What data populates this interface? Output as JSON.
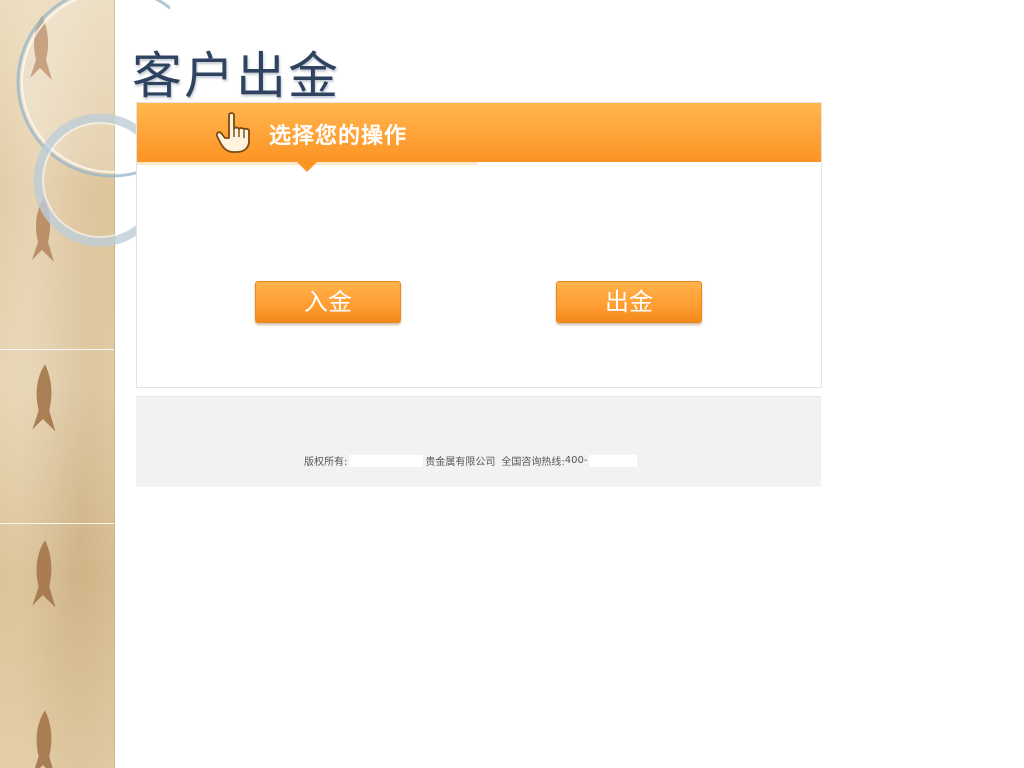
{
  "page": {
    "title": "客户出金"
  },
  "panel": {
    "header_title": "选择您的操作",
    "icon": "pointing-hand-icon"
  },
  "buttons": {
    "deposit_label": "入金",
    "withdraw_label": "出金"
  },
  "footer": {
    "copyright_prefix": "版权所有:",
    "company_suffix": "贵金属有限公司",
    "hotline_prefix": "全国咨询热线:",
    "hotline_number_start": "400-"
  },
  "colors": {
    "accent_orange": "#ffa43a",
    "title_blue": "#2f4361",
    "footer_bg": "#f2f2f2"
  }
}
